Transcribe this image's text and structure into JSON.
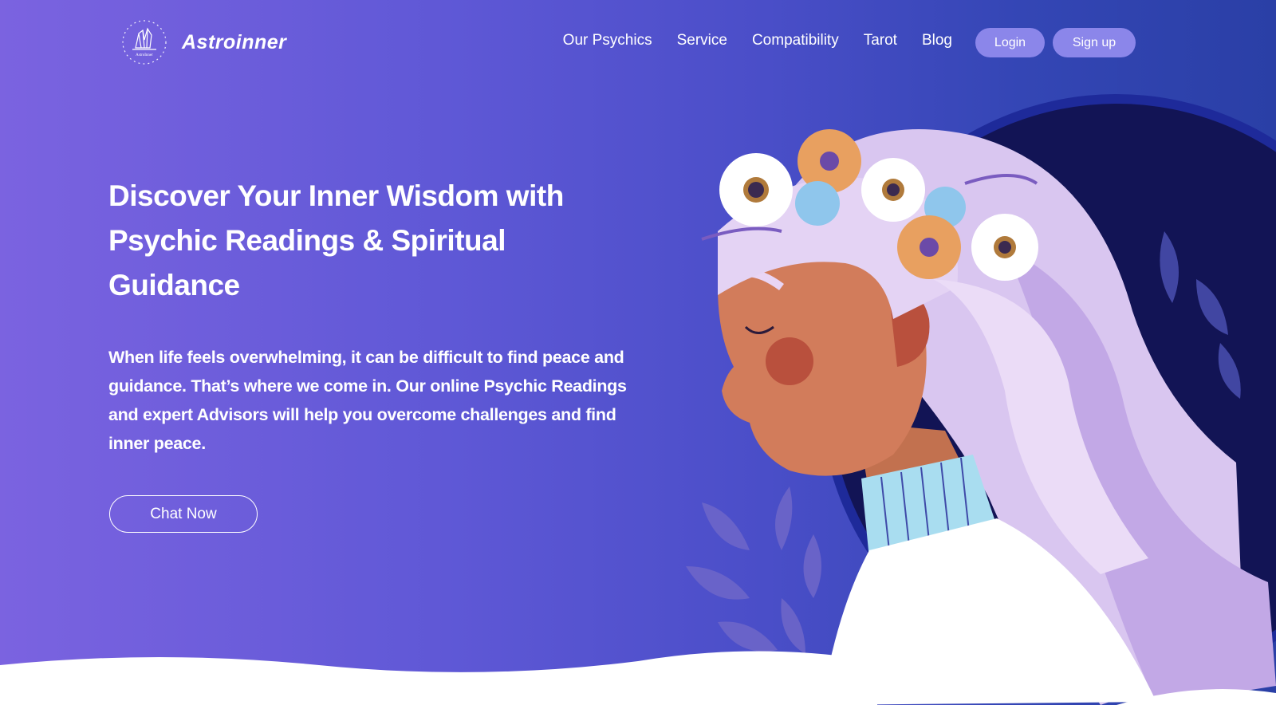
{
  "brand": {
    "name": "Astroinner",
    "logo_caption": "AstroInner"
  },
  "nav": {
    "items": [
      {
        "label": "Our Psychics"
      },
      {
        "label": "Service"
      },
      {
        "label": "Compatibility"
      },
      {
        "label": "Tarot"
      },
      {
        "label": "Blog"
      }
    ]
  },
  "auth": {
    "login_label": "Login",
    "signup_label": "Sign up"
  },
  "hero": {
    "title": "Discover Your Inner Wisdom with Psychic Readings & Spiritual Guidance",
    "description": "When life feels overwhelming, it can be difficult to find peace and guidance. That’s where we come in. Our online Psychic Readings and expert Advisors will help you overcome challenges and find inner peace.",
    "cta_label": "Chat Now"
  },
  "colors": {
    "gradient_start": "#7b63e0",
    "gradient_end": "#2a3fa6",
    "pill_button": "#8b86ea",
    "circle_dark": "#121455"
  },
  "icons": {
    "logo": "crystal-cluster-icon"
  }
}
